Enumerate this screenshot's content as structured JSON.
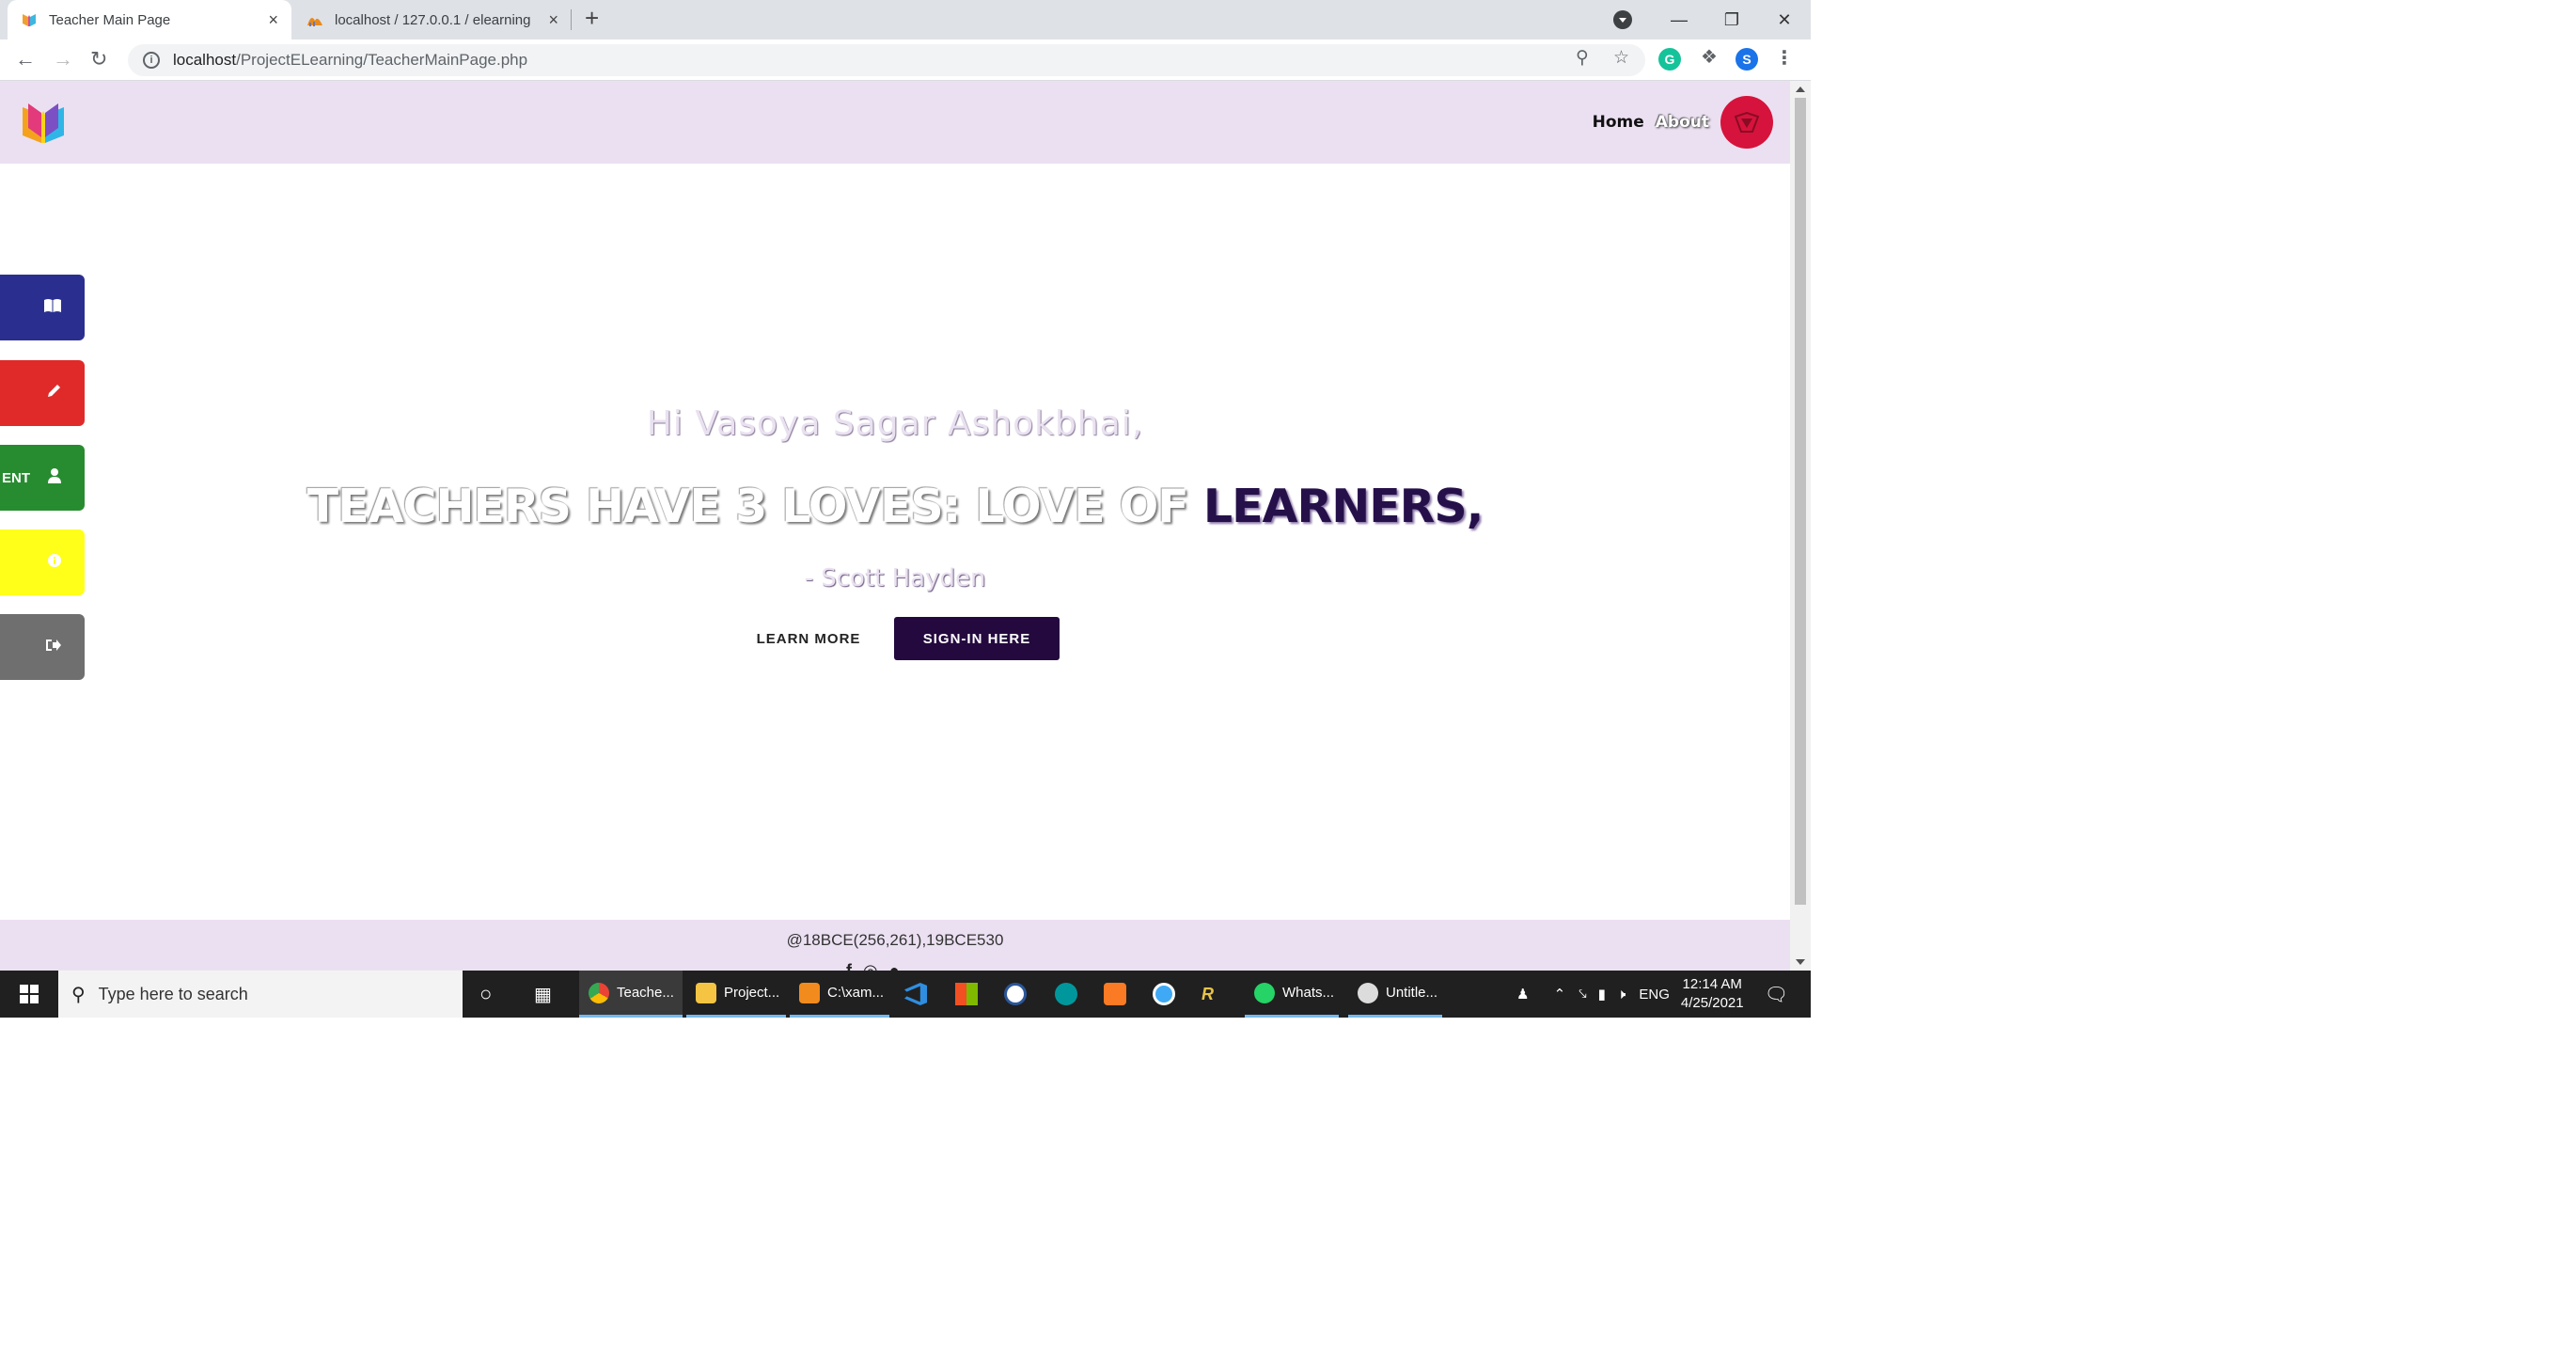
{
  "browser": {
    "tabs": [
      {
        "label": "Teacher Main Page",
        "close": "×"
      },
      {
        "label": "localhost / 127.0.0.1 / elearning",
        "close": "×"
      }
    ],
    "new_tab": "+",
    "url_host": "localhost",
    "url_path": "/ProjectELearning/TeacherMainPage.php",
    "window_controls": {
      "minimize": "—",
      "restore": "❐",
      "close": "✕"
    },
    "profile_initial": "S"
  },
  "site": {
    "nav": {
      "home": "Home",
      "about": "About"
    },
    "side_buttons": [
      {
        "name": "courses",
        "icon": "book-icon",
        "label": ""
      },
      {
        "name": "edit",
        "icon": "pencil-icon",
        "label": ""
      },
      {
        "name": "student",
        "icon": "user-icon",
        "label": "ENT"
      },
      {
        "name": "quiz",
        "icon": "info-icon",
        "label": ""
      },
      {
        "name": "logout",
        "icon": "sign-out-icon",
        "label": ""
      }
    ],
    "hero": {
      "greeting": "Hi Vasoya Sagar Ashokbhai,",
      "quote_main": "TEACHERS HAVE 3 LOVES: LOVE OF ",
      "quote_accent": "LEARNERS,",
      "author": "- Scott Hayden",
      "learn_more": "LEARN MORE",
      "sign_in": "SIGN-IN HERE"
    },
    "footer": {
      "credit": "@18BCE(256,261),19BCE530"
    },
    "colors": {
      "header_bg": "#ebe0f1",
      "accent_dark": "#24093f",
      "side_courses": "#2a2f8f",
      "side_edit": "#e02a2a",
      "side_student": "#278c30",
      "side_quiz": "#ffff1a",
      "side_logout": "#6f6f6f",
      "avatar": "#d6133c"
    }
  },
  "taskbar": {
    "search_placeholder": "Type here to search",
    "apps": [
      {
        "label": "Teache...",
        "active": true
      },
      {
        "label": "Project..."
      },
      {
        "label": "C:\\xam..."
      },
      {
        "label": "Whats..."
      },
      {
        "label": "Untitle..."
      }
    ],
    "lang": "ENG",
    "time": "12:14 AM",
    "date": "4/25/2021"
  }
}
